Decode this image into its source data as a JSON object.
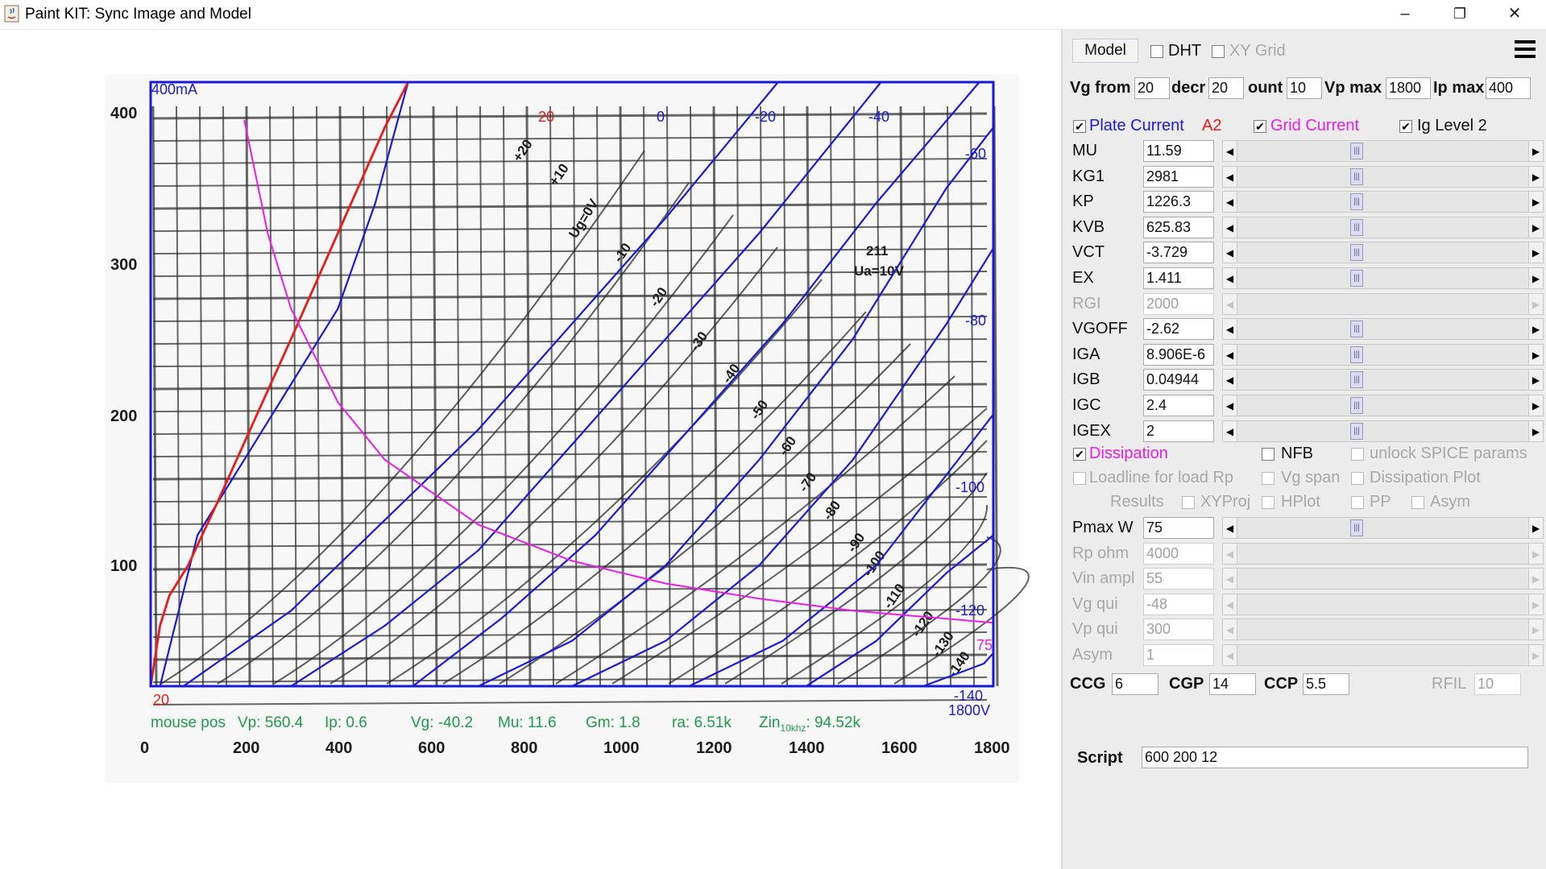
{
  "window": {
    "title": "Paint KIT: Sync Image and Model",
    "minimize_glyph": "–",
    "restore_glyph": "❐",
    "close_glyph": "✕"
  },
  "chart": {
    "corner_label": "400mA",
    "grid_labels": [
      {
        "text": "20",
        "color": "#e81c1c"
      },
      {
        "text": "0",
        "color": "#1a1ad6"
      },
      {
        "text": "-20",
        "color": "#1a1ad6"
      },
      {
        "text": "-40",
        "color": "#1a1ad6"
      },
      {
        "text": "-60",
        "color": "#1a1ad6"
      },
      {
        "text": "-80",
        "color": "#1a1ad6"
      },
      {
        "text": "-100",
        "color": "#1a1ad6"
      },
      {
        "text": "-120",
        "color": "#1a1ad6"
      },
      {
        "text": "-140",
        "color": "#1a1ad6"
      },
      {
        "text": "1800V",
        "color": "#1a1ad6"
      },
      {
        "text": "75",
        "color": "#e61ee6"
      },
      {
        "text": "20",
        "color": "#e81c1c"
      }
    ],
    "y_ticks": [
      "400",
      "300",
      "200",
      "100"
    ],
    "x_ticks": [
      "0",
      "200",
      "400",
      "600",
      "800",
      "1000",
      "1200",
      "1400",
      "1600",
      "1800"
    ],
    "scan_labels": [
      "+20",
      "+10",
      "Ug=0V",
      "-10",
      "-20",
      "-30",
      "-40",
      "-50",
      "-60",
      "-70",
      "-80",
      "-90",
      "-100",
      "-110",
      "-120",
      "-130",
      "-140",
      "211",
      "Ua=10V"
    ],
    "mouse": {
      "prefix": "mouse pos",
      "vp": "Vp: 560.4",
      "ip": "Ip: 0.6",
      "vg": "Vg: -40.2",
      "mu": "Mu: 11.6",
      "gm": "Gm: 1.8",
      "ra": "ra: 6.51k",
      "zin": "Zin",
      "zin_sub": "10khz",
      "zin_val": ": 94.52k"
    },
    "colors": {
      "frame": "#1a1ad6",
      "plate": "#1a1ad6",
      "grid_current": "#e81c1c",
      "dissipation": "#e61ee6",
      "status": "#1f9a4a",
      "paper_grid": "#2a2a2a"
    },
    "chart_data": {
      "type": "line",
      "xlabel": "",
      "ylabel": "",
      "xlim": [
        0,
        1800
      ],
      "ylim": [
        0,
        400
      ],
      "series": [
        {
          "name": "20",
          "x": [
            20,
            100,
            200,
            300,
            400,
            480,
            550
          ],
          "y": [
            0,
            100,
            150,
            200,
            250,
            320,
            400
          ]
        },
        {
          "name": "0",
          "x": [
            70,
            300,
            500,
            700,
            900,
            1100,
            1340
          ],
          "y": [
            0,
            50,
            110,
            170,
            240,
            310,
            400
          ]
        },
        {
          "name": "-20",
          "x": [
            300,
            500,
            700,
            900,
            1100,
            1300,
            1560
          ],
          "y": [
            0,
            40,
            90,
            160,
            230,
            300,
            400
          ]
        },
        {
          "name": "-40",
          "x": [
            560,
            750,
            950,
            1150,
            1350,
            1550,
            1770
          ],
          "y": [
            0,
            45,
            100,
            170,
            240,
            320,
            400
          ]
        },
        {
          "name": "-60",
          "x": [
            700,
            900,
            1100,
            1300,
            1500,
            1700,
            1800
          ],
          "y": [
            0,
            30,
            80,
            150,
            230,
            330,
            370
          ]
        },
        {
          "name": "-80",
          "x": [
            900,
            1100,
            1300,
            1500,
            1700,
            1800
          ],
          "y": [
            0,
            30,
            80,
            150,
            240,
            290
          ]
        },
        {
          "name": "-100",
          "x": [
            1150,
            1350,
            1550,
            1700,
            1800
          ],
          "y": [
            0,
            30,
            80,
            140,
            180
          ]
        },
        {
          "name": "-120",
          "x": [
            1400,
            1550,
            1700,
            1800
          ],
          "y": [
            0,
            30,
            75,
            100
          ]
        },
        {
          "name": "-140",
          "x": [
            1650,
            1720,
            1780,
            1800
          ],
          "y": [
            0,
            8,
            15,
            22
          ]
        },
        {
          "name": "Ig 20",
          "x": [
            0,
            10,
            20,
            40,
            80,
            140,
            220,
            300,
            400,
            500,
            550
          ],
          "y": [
            0,
            20,
            40,
            60,
            80,
            120,
            175,
            230,
            300,
            370,
            400
          ]
        },
        {
          "name": "Pmax 75W",
          "x": [
            200,
            250,
            300,
            400,
            500,
            700,
            900,
            1100,
            1300,
            1500,
            1800
          ],
          "y": [
            375,
            300,
            250,
            188,
            150,
            107,
            83,
            68,
            58,
            50,
            42
          ]
        }
      ]
    }
  },
  "panel": {
    "model_button": "Model",
    "dht": {
      "label": "DHT",
      "checked": false
    },
    "xy_grid": {
      "label": "XY Grid",
      "checked": false
    },
    "row1": {
      "vg_from_label": "Vg from",
      "vg_from": "20",
      "decr_label": "decr",
      "decr": "20",
      "count_label": "ount",
      "count": "10",
      "vp_max_label": "Vp max",
      "vp_max": "1800",
      "ip_max_label": "Ip max",
      "ip_max": "400"
    },
    "plate_current": {
      "label": "Plate Current",
      "checked": true,
      "color": "#1a1ad6"
    },
    "a2_label": "A2",
    "grid_current": {
      "label": "Grid Current",
      "checked": true,
      "color": "#e61ee6"
    },
    "ig_level": {
      "label": "Ig Level 2",
      "checked": true
    },
    "params": [
      {
        "name": "MU",
        "value": "11.59",
        "enabled": true
      },
      {
        "name": "KG1",
        "value": "2981",
        "enabled": true
      },
      {
        "name": "KP",
        "value": "1226.3",
        "enabled": true
      },
      {
        "name": "KVB",
        "value": "625.83",
        "enabled": true
      },
      {
        "name": "VCT",
        "value": "-3.729",
        "enabled": true
      },
      {
        "name": "EX",
        "value": "1.411",
        "enabled": true
      },
      {
        "name": "RGI",
        "value": "2000",
        "enabled": false
      },
      {
        "name": "VGOFF",
        "value": "-2.62",
        "enabled": true
      },
      {
        "name": "IGA",
        "value": "8.906E-6",
        "enabled": true
      },
      {
        "name": "IGB",
        "value": "0.04944",
        "enabled": true
      },
      {
        "name": "IGC",
        "value": "2.4",
        "enabled": true
      },
      {
        "name": "IGEX",
        "value": "2",
        "enabled": true
      }
    ],
    "dissipation": {
      "label": "Dissipation",
      "checked": true,
      "color": "#e61ee6"
    },
    "nfb": {
      "label": "NFB",
      "checked": false
    },
    "unlock_spice": {
      "label": "unlock SPICE params",
      "checked": false
    },
    "loadline": {
      "label": "Loadline for load Rp",
      "checked": false
    },
    "vg_span": {
      "label": "Vg span",
      "checked": false
    },
    "dissipation_plot": {
      "label": "Dissipation Plot",
      "checked": false
    },
    "results_label": "Results",
    "xyproj": {
      "label": "XYProj",
      "checked": false
    },
    "hplot": {
      "label": "HPlot",
      "checked": false
    },
    "pp": {
      "label": "PP",
      "checked": false
    },
    "asym_cb": {
      "label": "Asym",
      "checked": false
    },
    "loads": [
      {
        "name": "Pmax W",
        "value": "75",
        "enabled": true
      },
      {
        "name": "Rp ohm",
        "value": "4000",
        "enabled": false
      },
      {
        "name": "Vin ampl",
        "value": "55",
        "enabled": false
      },
      {
        "name": "Vg qui",
        "value": "-48",
        "enabled": false
      },
      {
        "name": "Vp qui",
        "value": "300",
        "enabled": false
      },
      {
        "name": "Asym",
        "value": "1",
        "enabled": false
      }
    ],
    "ccg_label": "CCG",
    "ccg": "6",
    "cgp_label": "CGP",
    "cgp": "14",
    "ccp_label": "CCP",
    "ccp": "5.5",
    "rfil_label": "RFIL",
    "rfil": "10",
    "script_label": "Script",
    "script": "600 200 12"
  }
}
